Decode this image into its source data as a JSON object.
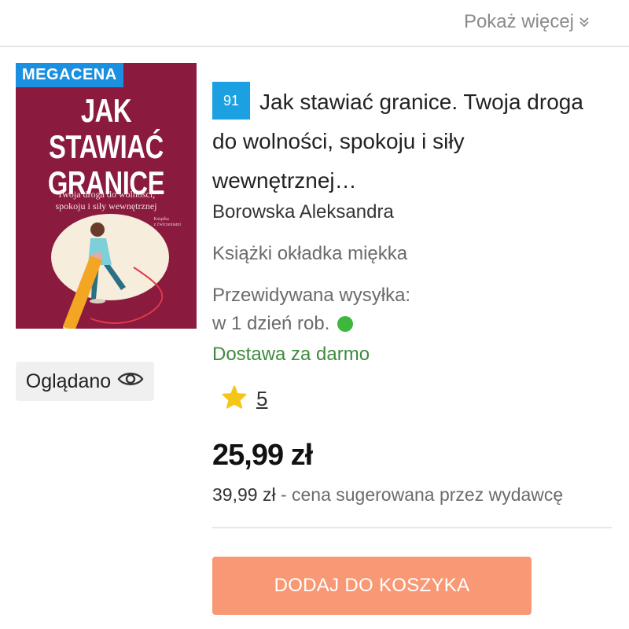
{
  "header": {
    "show_more_label": "Pokaż więcej",
    "show_more_icon": "double-chevron-down-icon"
  },
  "product": {
    "cover": {
      "badge": "MEGACENA",
      "title_line1": "JAK STAWIAĆ",
      "title_line2": "GRANICE",
      "subtitle_line1": "Twoja droga do wolności,",
      "subtitle_line2": "spokoju i siły wewnętrznej",
      "small_text_line1": "Książka",
      "small_text_line2": "z ćwiczeniami",
      "background_color": "#8a1a3e"
    },
    "watched_label": "Oglądano",
    "rank": "91",
    "title": "Jak stawiać granice. Twoja droga do wolności, spokoju i siły wewnętrznej…",
    "author": "Borowska Aleksandra",
    "format": "Książki okładka miękka",
    "shipping_label": "Przewidywana wysyłka:",
    "shipping_time": "w 1 dzień rob.",
    "shipping_status_color": "#3db83d",
    "free_delivery": "Dostawa za darmo",
    "rating": "5",
    "price": "25,99 zł",
    "suggested_price": "39,99 zł",
    "suggested_note": " - cena sugerowana przez wydawcę",
    "add_to_cart": "DODAJ DO KOSZYKA"
  },
  "colors": {
    "accent_blue": "#1ba1e2",
    "cart_button": "#f99874",
    "free_delivery_green": "#3f8a3f",
    "star": "#f5c518"
  }
}
